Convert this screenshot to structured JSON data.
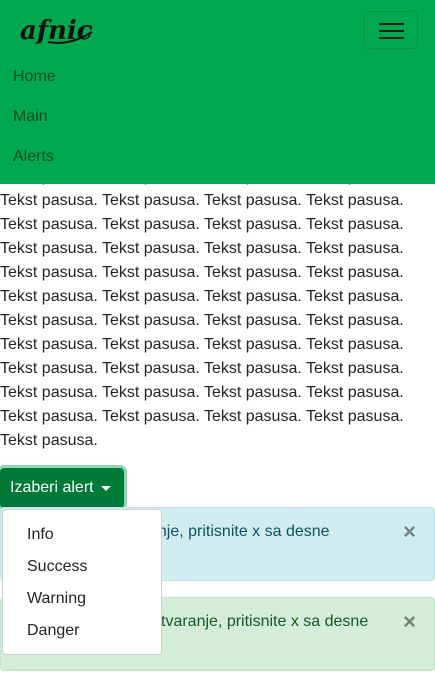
{
  "brand": {
    "logo_text": "afnic"
  },
  "nav": {
    "items": [
      {
        "label": "Home"
      },
      {
        "label": "Main"
      },
      {
        "label": "Alerts"
      }
    ]
  },
  "content": {
    "paragraph": "Tekst pasusa. Tekst pasusa. Tekst pasusa. Tekst pasusa. Tekst pasusa. Tekst pasusa. Tekst pasusa. Tekst pasusa. Tekst pasusa. Tekst pasusa. Tekst pasusa. Tekst pasusa. Tekst pasusa. Tekst pasusa. Tekst pasusa. Tekst pasusa. Tekst pasusa. Tekst pasusa. Tekst pasusa. Tekst pasusa. Tekst pasusa. Tekst pasusa. Tekst pasusa. Tekst pasusa. Tekst pasusa. Tekst pasusa. Tekst pasusa. Tekst pasusa. Tekst pasusa. Tekst pasusa. Tekst pasusa. Tekst pasusa. Tekst pasusa. Tekst pasusa. Tekst pasusa. Tekst pasusa. Tekst pasusa. Tekst pasusa. Tekst pasusa. Tekst pasusa. Tekst pasusa. Tekst pasusa. Tekst pasusa. Tekst pasusa. Tekst pasusa."
  },
  "dropdown": {
    "button_label": "Izaberi alert",
    "items": [
      {
        "label": "Info"
      },
      {
        "label": "Success"
      },
      {
        "label": "Warning"
      },
      {
        "label": "Danger"
      }
    ]
  },
  "alerts": [
    {
      "text": "anje, pritisnite x sa desne",
      "close": "×"
    },
    {
      "text": "tvaranje, pritisnite x sa desne",
      "close": "×"
    }
  ],
  "colors": {
    "navbar": "#00a94f",
    "button": "#007a36",
    "alert_info_bg": "#d1ecf1",
    "alert_success_bg": "#d4edda"
  }
}
